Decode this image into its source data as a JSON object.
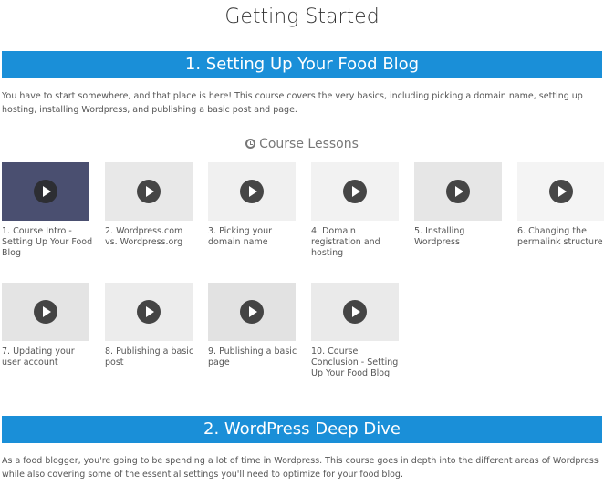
{
  "page_title": "Getting Started",
  "sections": [
    {
      "title": "1. Setting Up Your Food Blog",
      "description": "You have to start somewhere, and that place is here! This course covers the very basics, including picking a domain name, setting up hosting, installing Wordpress, and publishing a basic post and page."
    },
    {
      "title": "2. WordPress Deep Dive",
      "description": "As a food blogger, you're going to be spending a lot of time in Wordpress. This course goes in depth into the different areas of Wordpress while also covering some of the essential settings you'll need to optimize for your food blog."
    }
  ],
  "lessons_heading": "Course Lessons",
  "lessons_icon": "clock-icon",
  "accent_color": "#1a8fd8",
  "lessons": [
    {
      "label": "1. Course Intro - Setting Up Your Food Blog",
      "thumb": "#4a4f70"
    },
    {
      "label": "2. Wordpress.com vs. Wordpress.org",
      "thumb": "#e8e8e8"
    },
    {
      "label": "3. Picking your domain name",
      "thumb": "#f0f0f0"
    },
    {
      "label": "4. Domain registration and hosting",
      "thumb": "#f2f2f2"
    },
    {
      "label": "5. Installing Wordpress",
      "thumb": "#e6e6e6"
    },
    {
      "label": "6. Changing the permalink structure",
      "thumb": "#f4f4f4"
    },
    {
      "label": "7. Updating your user account",
      "thumb": "#e4e4e4"
    },
    {
      "label": "8. Publishing a basic post",
      "thumb": "#ececec"
    },
    {
      "label": "9. Publishing a basic page",
      "thumb": "#e2e2e2"
    },
    {
      "label": "10. Course Conclusion - Setting Up Your Food Blog",
      "thumb": "#eaeaea"
    }
  ]
}
